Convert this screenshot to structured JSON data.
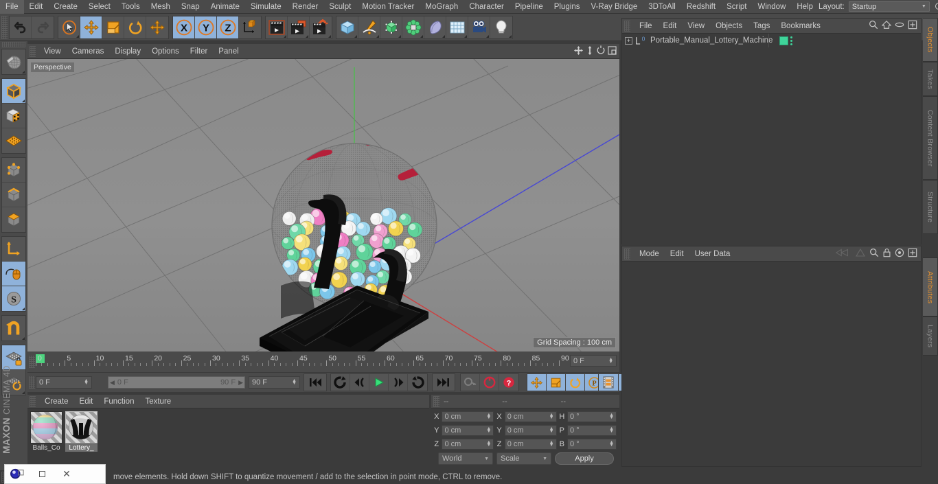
{
  "menu": {
    "items": [
      "File",
      "Edit",
      "Create",
      "Select",
      "Tools",
      "Mesh",
      "Snap",
      "Animate",
      "Simulate",
      "Render",
      "Sculpt",
      "Motion Tracker",
      "MoGraph",
      "Character",
      "Pipeline",
      "Plugins",
      "V-Ray Bridge",
      "3DToAll",
      "Redshift",
      "Script",
      "Window",
      "Help"
    ],
    "layout_label": "Layout:",
    "layout_value": "Startup",
    "search_icon": "search-icon"
  },
  "toolbar": {
    "groups": [
      {
        "name": "undo-redo",
        "buttons": [
          {
            "name": "undo-button",
            "icon": "undo-arrow-icon",
            "active": false
          },
          {
            "name": "redo-button",
            "icon": "redo-arrow-icon",
            "active": false
          }
        ]
      },
      {
        "name": "transform-tools",
        "buttons": [
          {
            "name": "live-selection-tool",
            "icon": "cursor-circle-icon",
            "active": false
          },
          {
            "name": "move-tool",
            "icon": "move-arrows-icon",
            "active": true
          },
          {
            "name": "scale-tool",
            "icon": "scale-box-icon",
            "active": false
          },
          {
            "name": "rotate-tool",
            "icon": "rotate-ring-icon",
            "active": false
          },
          {
            "name": "dynamic-place-tool",
            "icon": "plus-arrows-icon",
            "active": false
          }
        ]
      },
      {
        "name": "axis-locks",
        "buttons": [
          {
            "name": "lock-x-axis-button",
            "icon": "x-axis-icon",
            "active": true
          },
          {
            "name": "lock-y-axis-button",
            "icon": "y-axis-icon",
            "active": true
          },
          {
            "name": "lock-z-axis-button",
            "icon": "z-axis-icon",
            "active": true
          },
          {
            "name": "world-object-axis-button",
            "icon": "world-axis-icon",
            "active": false
          }
        ]
      },
      {
        "name": "render-tools",
        "buttons": [
          {
            "name": "render-view-button",
            "icon": "clapperboard-icon",
            "active": false
          },
          {
            "name": "render-to-picture-viewer-button",
            "icon": "clapperboard-picture-icon",
            "active": false
          },
          {
            "name": "edit-render-settings-button",
            "icon": "clapperboard-gear-icon",
            "active": false
          }
        ]
      },
      {
        "name": "object-creation",
        "buttons": [
          {
            "name": "add-cube-button",
            "icon": "cube-icon",
            "active": false
          },
          {
            "name": "add-spline-button",
            "icon": "pen-spline-icon",
            "active": false
          },
          {
            "name": "add-generator-button",
            "icon": "green-cube-icon",
            "active": false
          },
          {
            "name": "add-deformer-button",
            "icon": "green-cluster-icon",
            "active": false
          },
          {
            "name": "add-scene-object-button",
            "icon": "purple-shape-icon",
            "active": false
          },
          {
            "name": "add-environment-button",
            "icon": "floor-grid-icon",
            "active": false
          },
          {
            "name": "add-camera-button",
            "icon": "camera-icon",
            "active": false
          },
          {
            "name": "add-light-button",
            "icon": "lightbulb-icon",
            "active": false
          }
        ]
      }
    ]
  },
  "left_toolbar": {
    "groups": [
      {
        "name": "tool-presets",
        "buttons": [
          {
            "name": "make-editable-button",
            "icon": "globe-wireframe-icon",
            "active": false
          }
        ]
      },
      {
        "name": "editor-modes",
        "buttons": [
          {
            "name": "model-mode-button",
            "icon": "model-cube-icon",
            "active": true
          },
          {
            "name": "texture-mode-button",
            "icon": "texture-cube-icon",
            "active": false
          },
          {
            "name": "uv-mode-button",
            "icon": "uv-mesh-icon",
            "active": false
          }
        ]
      },
      {
        "name": "component-modes",
        "buttons": [
          {
            "name": "points-mode-button",
            "icon": "points-cube-icon",
            "active": false
          },
          {
            "name": "edges-mode-button",
            "icon": "edges-cube-icon",
            "active": false
          },
          {
            "name": "polygons-mode-button",
            "icon": "polygons-cube-icon",
            "active": false
          }
        ]
      },
      {
        "name": "axis-and-viewport",
        "buttons": [
          {
            "name": "enable-axis-button",
            "icon": "axis-l-icon",
            "active": false
          },
          {
            "name": "viewport-solo-button",
            "icon": "mouse-icon",
            "active": true
          },
          {
            "name": "enable-snapping-button",
            "icon": "snap-s-icon",
            "active": true
          }
        ]
      },
      {
        "name": "magnet",
        "buttons": [
          {
            "name": "magnet-tool-button",
            "icon": "magnet-icon",
            "active": false
          }
        ]
      },
      {
        "name": "workplane",
        "buttons": [
          {
            "name": "lock-workplane-button",
            "icon": "workplane-lock-icon",
            "active": true
          },
          {
            "name": "align-workplane-button",
            "icon": "workplane-rotate-icon",
            "active": false
          }
        ]
      }
    ],
    "brand_maxon": "MAXON",
    "brand_product": "CINEMA 4D"
  },
  "viewport": {
    "menu": [
      "View",
      "Cameras",
      "Display",
      "Options",
      "Filter",
      "Panel"
    ],
    "header_icons": [
      "pan-icon",
      "zoom-icon",
      "rotate-icon",
      "maximize-icon"
    ],
    "perspective_label": "Perspective",
    "grid_spacing_label": "Grid Spacing : 100 cm",
    "scene_description": "Portable manual lottery machine with colored balls inside a transparent drum on a black base"
  },
  "timeline": {
    "ticks": [
      "0",
      "5",
      "10",
      "15",
      "20",
      "25",
      "30",
      "35",
      "40",
      "45",
      "50",
      "55",
      "60",
      "65",
      "70",
      "75",
      "80",
      "85",
      "90"
    ],
    "current_frame_field": "0 F",
    "playhead_frame": 0
  },
  "animbar": {
    "current_frame": "0 F",
    "range_start": "0 F",
    "range_end": "90 F",
    "end_frame": "90 F",
    "buttons": [
      {
        "name": "go-to-start-button",
        "icon": "skip-start-icon",
        "active": false
      },
      {
        "name": "go-to-previous-keyframe-button",
        "icon": "prev-key-icon",
        "active": false
      },
      {
        "name": "go-to-previous-frame-button",
        "icon": "step-back-icon",
        "active": false
      },
      {
        "name": "play-button",
        "icon": "play-icon",
        "active": false
      },
      {
        "name": "go-to-next-frame-button",
        "icon": "step-forward-icon",
        "active": false
      },
      {
        "name": "go-to-next-keyframe-button",
        "icon": "next-key-icon",
        "active": false
      },
      {
        "name": "go-to-end-button",
        "icon": "skip-end-icon",
        "active": false
      }
    ],
    "record_buttons": [
      {
        "name": "record-active-objects-button",
        "icon": "key-icon",
        "active": false
      },
      {
        "name": "autokeying-button",
        "icon": "red-circle-icon",
        "active": false
      },
      {
        "name": "keyframe-selection-button",
        "icon": "red-question-icon",
        "active": false
      }
    ],
    "position_buttons": [
      {
        "name": "record-position-button",
        "icon": "move-arrows-icon",
        "active": true
      },
      {
        "name": "record-scale-button",
        "icon": "scale-box-icon",
        "active": true
      },
      {
        "name": "record-rotation-button",
        "icon": "rotate-ring-icon",
        "active": true
      },
      {
        "name": "record-parameter-button",
        "icon": "parameter-p-icon",
        "active": true
      },
      {
        "name": "record-pla-button",
        "icon": "point-level-anim-icon",
        "active": true
      }
    ],
    "timeline_toggle": {
      "name": "animation-layers-button",
      "icon": "film-strip-icon",
      "active": true
    }
  },
  "material_manager": {
    "menu": [
      "Create",
      "Edit",
      "Function",
      "Texture"
    ],
    "materials": [
      {
        "name": "Balls_Co",
        "selected": false,
        "type": "rainbow-sphere"
      },
      {
        "name": "Lottery_",
        "selected": true,
        "type": "dark-machine"
      }
    ]
  },
  "coordinates": {
    "header_dashes": [
      "--",
      "--",
      "--"
    ],
    "rows": [
      {
        "axis1": "X",
        "value1": "0 cm",
        "axis2": "X",
        "value2": "0 cm",
        "axis3": "H",
        "value3": "0 °"
      },
      {
        "axis1": "Y",
        "value1": "0 cm",
        "axis2": "Y",
        "value2": "0 cm",
        "axis3": "P",
        "value3": "0 °"
      },
      {
        "axis1": "Z",
        "value1": "0 cm",
        "axis2": "Z",
        "value2": "0 cm",
        "axis3": "B",
        "value3": "0 °"
      }
    ],
    "coord_system": "World",
    "transform_mode": "Scale",
    "apply_label": "Apply"
  },
  "object_manager": {
    "menu": [
      "File",
      "Edit",
      "View",
      "Objects",
      "Tags",
      "Bookmarks"
    ],
    "header_icons": [
      "search-icon",
      "home-icon",
      "ellipse-icon",
      "plus-box-icon"
    ],
    "objects": [
      {
        "name": "Portable_Manual_Lottery_Machine",
        "level": 0,
        "expand": "+",
        "icon": "null-object-icon",
        "tag_color": "#3fd49a"
      }
    ]
  },
  "attribute_manager": {
    "menu": [
      "Mode",
      "Edit",
      "User Data"
    ],
    "header_icons": [
      "prev-arrow-icon",
      "next-arrow-icon",
      "search-icon",
      "lock-icon",
      "target-icon",
      "plus-box-icon"
    ]
  },
  "right_tabs": {
    "top": [
      {
        "label": "Objects",
        "active": true
      },
      {
        "label": "Takes",
        "active": false
      },
      {
        "label": "Content Browser",
        "active": false
      },
      {
        "label": "Structure",
        "active": false
      }
    ],
    "bottom": [
      {
        "label": "Attributes",
        "active": true
      },
      {
        "label": "Layers",
        "active": false
      }
    ]
  },
  "status_bar": {
    "message": "move elements. Hold down SHIFT to quantize movement / add to the selection in point mode, CTRL to remove."
  },
  "overlay_window": {
    "restore_label": "❐",
    "minimize_label": "□",
    "close_label": "✕"
  },
  "colors": {
    "panel_bg": "#3b3b3b",
    "header_bg": "#4a4a4a",
    "accent_blue": "#8fb2da",
    "accent_orange": "#e8922e",
    "tag_green": "#3fd49a",
    "viewport_bg": "#8d8d8d"
  }
}
